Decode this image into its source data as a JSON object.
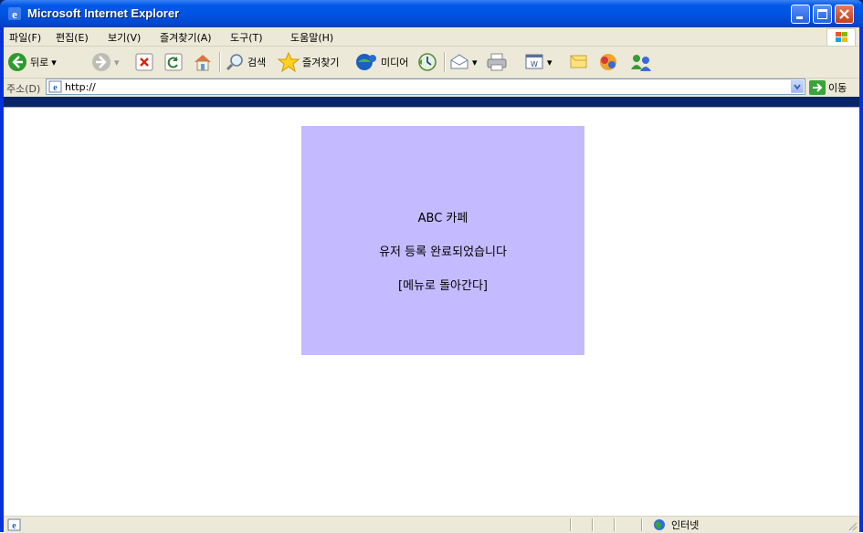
{
  "window": {
    "title": "Microsoft Internet Explorer"
  },
  "menu": [
    {
      "label": "파일(F)"
    },
    {
      "label": "편집(E)"
    },
    {
      "label": "보기(V)"
    },
    {
      "label": "즐겨찾기(A)"
    },
    {
      "label": "도구(T)"
    },
    {
      "label": "도움말(H)"
    }
  ],
  "toolbar": {
    "back_label": "뒤로",
    "search_label": "검색",
    "favorites_label": "즐겨찾기",
    "media_label": "미디어"
  },
  "address": {
    "label": "주소(D)",
    "value": "http://",
    "go_label": "이동"
  },
  "page": {
    "heading": "ABC 카페",
    "message": "유저 등록 완료되었습니다",
    "link": "[메뉴로 돌아간다]",
    "panel_color": "#c4baff"
  },
  "status": {
    "zone": "인터넷"
  },
  "icons": {
    "app": "ie-icon",
    "minimize": "minimize-icon",
    "maximize": "maximize-icon",
    "close": "close-icon",
    "back": "back-arrow-icon",
    "forward": "forward-arrow-icon",
    "stop": "stop-icon",
    "refresh": "refresh-icon",
    "home": "home-icon",
    "search": "search-icon",
    "favorites": "star-icon",
    "media": "media-icon",
    "history": "history-icon",
    "mail": "mail-icon",
    "print": "print-icon",
    "edit": "word-icon",
    "discuss": "discuss-icon",
    "messenger": "messenger-icon",
    "go": "go-arrow-icon",
    "zone": "globe-icon"
  }
}
